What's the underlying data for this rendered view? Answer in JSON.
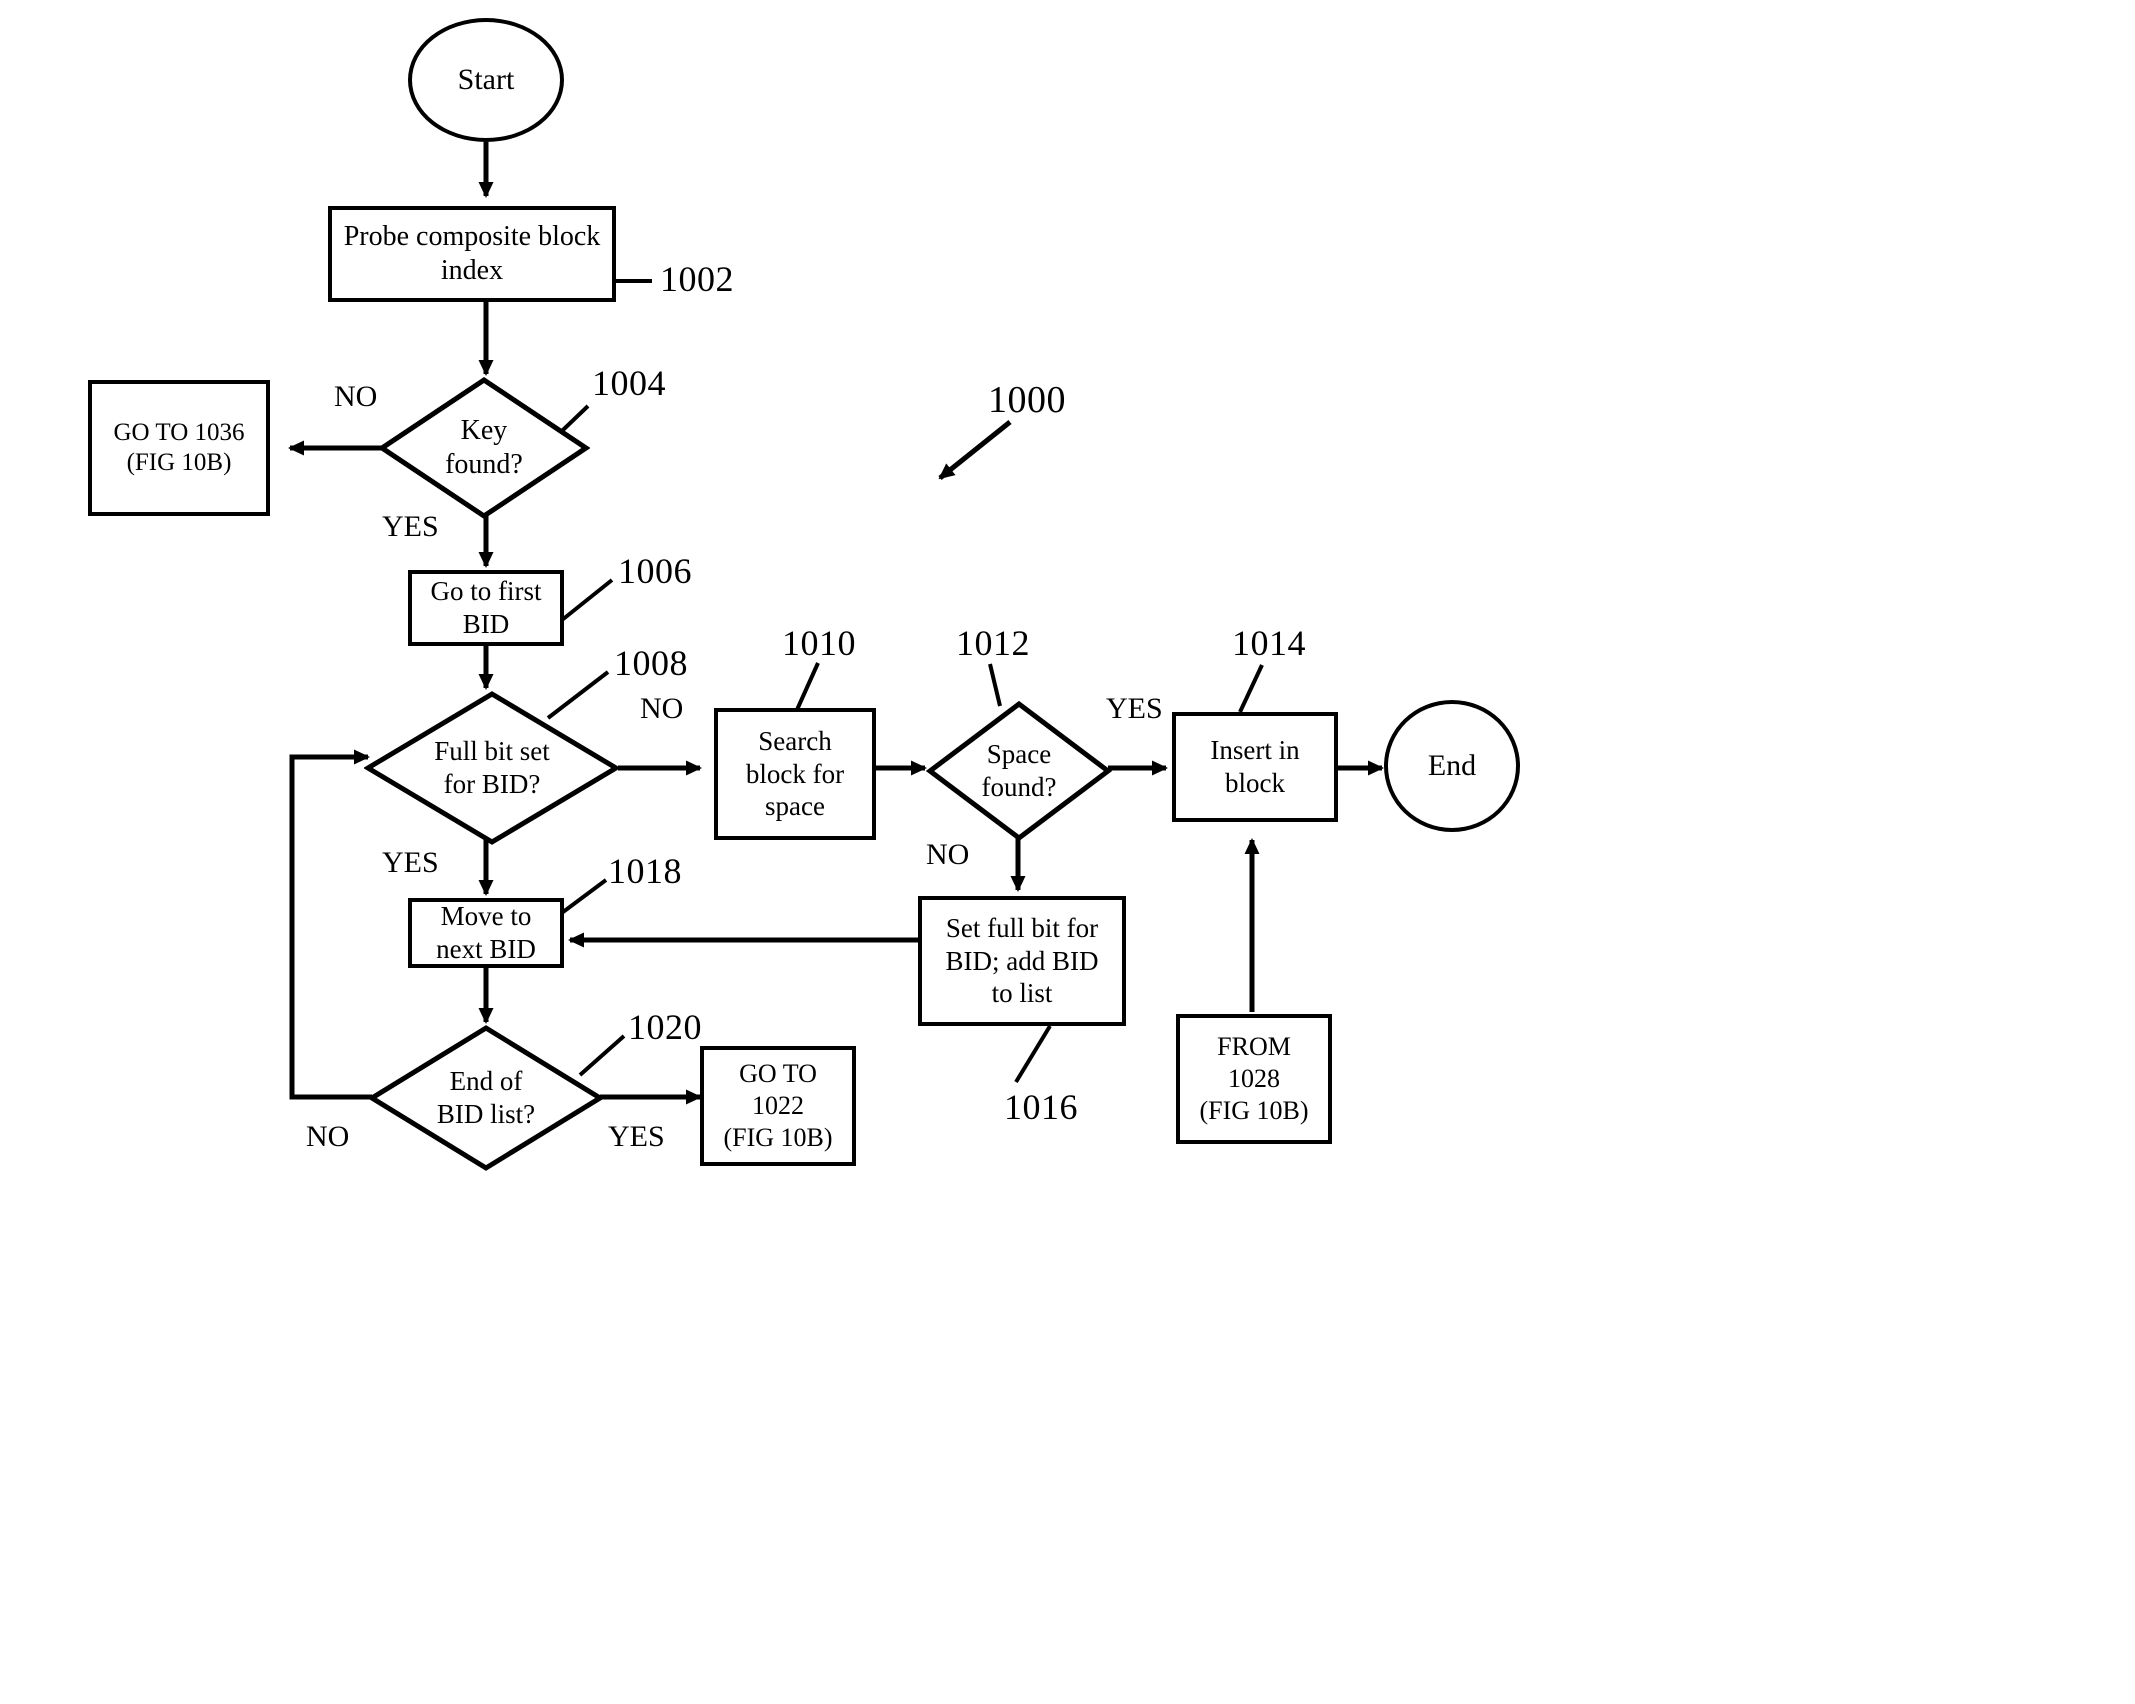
{
  "figure": {
    "title_ref": "1000",
    "nodes": {
      "start": {
        "label": "Start"
      },
      "probe": {
        "line1": "Probe composite block",
        "line2": "index"
      },
      "key_found": {
        "line1": "Key",
        "line2": "found?"
      },
      "goto_1036": {
        "line1": "GO TO 1036",
        "line2": "(FIG 10B)"
      },
      "go_first_bid": {
        "line1": "Go to first",
        "line2": "BID"
      },
      "full_bit_set": {
        "line1": "Full bit set",
        "line2": "for BID?"
      },
      "search_block": {
        "line1": "Search",
        "line2": "block for",
        "line3": "space"
      },
      "space_found": {
        "line1": "Space",
        "line2": "found?"
      },
      "insert_block": {
        "line1": "Insert in",
        "line2": "block"
      },
      "end": {
        "label": "End"
      },
      "set_full_bit": {
        "line1": "Set full bit for",
        "line2": "BID; add BID",
        "line3": "to list"
      },
      "move_next_bid": {
        "line1": "Move to",
        "line2": "next BID"
      },
      "end_bid_list": {
        "line1": "End of",
        "line2": "BID list?"
      },
      "goto_1022": {
        "line1": "GO TO",
        "line2": "1022",
        "line3": "(FIG 10B)"
      },
      "from_1028": {
        "line1": "FROM",
        "line2": "1028",
        "line3": "(FIG 10B)"
      }
    },
    "refs": {
      "r1002": "1002",
      "r1004": "1004",
      "r1006": "1006",
      "r1008": "1008",
      "r1010": "1010",
      "r1012": "1012",
      "r1014": "1014",
      "r1016": "1016",
      "r1018": "1018",
      "r1020": "1020",
      "r1000": "1000"
    },
    "edge_labels": {
      "key_no": "NO",
      "key_yes": "YES",
      "full_no": "NO",
      "full_yes": "YES",
      "space_yes": "YES",
      "space_no": "NO",
      "endlist_no": "NO",
      "endlist_yes": "YES"
    }
  }
}
